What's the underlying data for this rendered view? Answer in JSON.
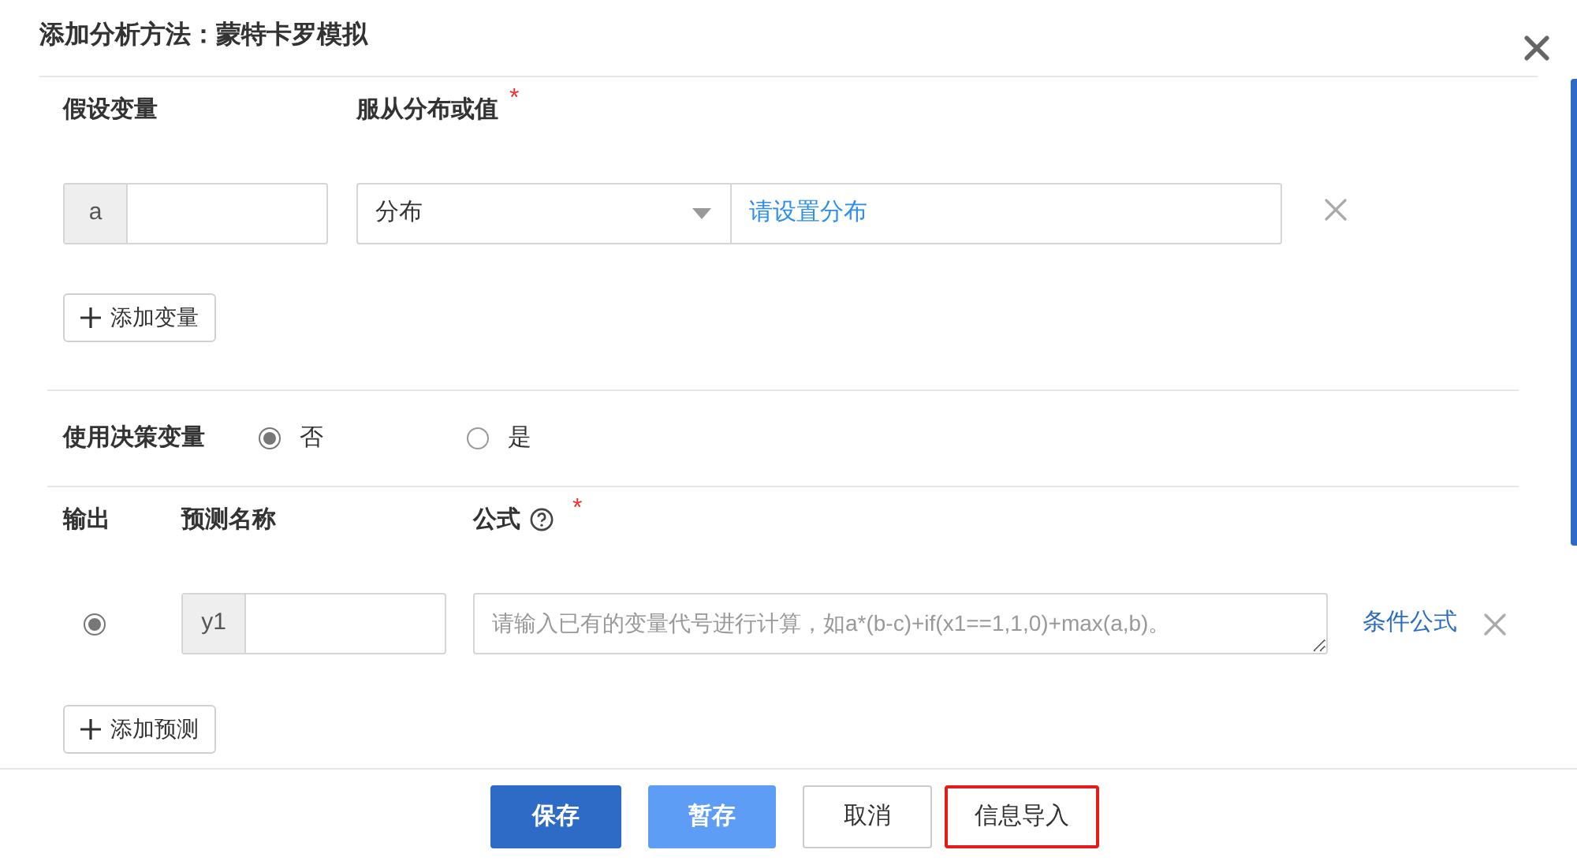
{
  "dialog": {
    "title": "添加分析方法：蒙特卡罗模拟"
  },
  "variables": {
    "headers": [
      {
        "label": "假设变量"
      },
      {
        "label": "服从分布或值",
        "required_mark": "*"
      }
    ],
    "rows": [
      {
        "code": "a",
        "type": "分布",
        "link": "请设置分布"
      }
    ],
    "add_button": "添加变量"
  },
  "decision": {
    "label": "使用决策变量",
    "options": [
      {
        "label": "否",
        "selected": true
      },
      {
        "label": "是",
        "selected": false
      }
    ]
  },
  "outputs": {
    "headers": [
      {
        "label": "输出"
      },
      {
        "label": "预测名称"
      },
      {
        "label": "公式",
        "help": true,
        "required_mark": "*"
      }
    ],
    "rows": [
      {
        "selected": true,
        "code": "y1",
        "placeholder": "请输入已有的变量代号进行计算，如a*(b-c)+if(x1==1,1,0)+max(a,b)。",
        "link": "条件公式"
      }
    ],
    "add_button": "添加预测"
  },
  "buttons": [
    {
      "label": "保存",
      "kind": "primary"
    },
    {
      "label": "暂存",
      "kind": "light"
    },
    {
      "label": "取消",
      "kind": "default"
    },
    {
      "label": "信息导入",
      "kind": "highlighted"
    }
  ]
}
